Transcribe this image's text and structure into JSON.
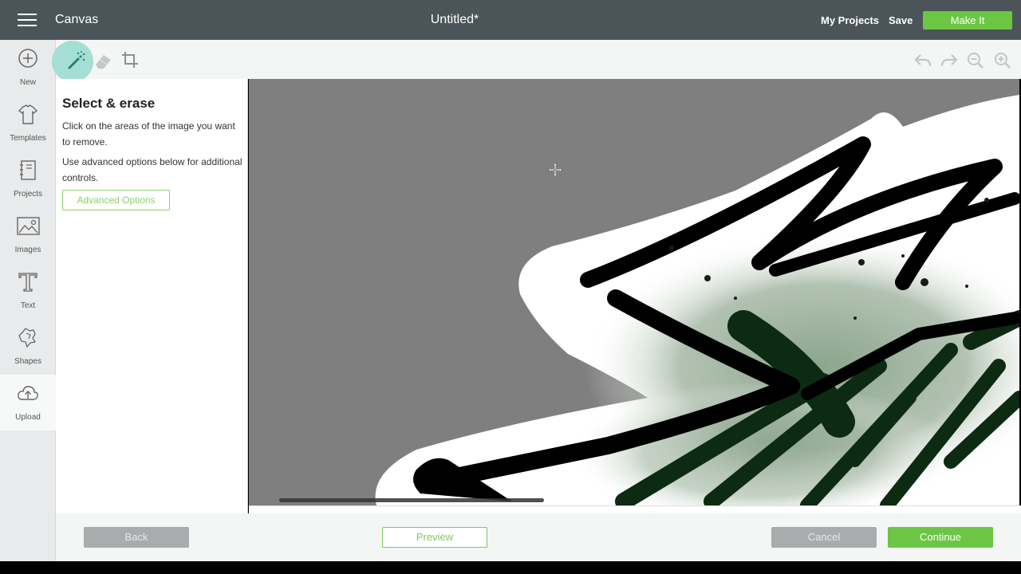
{
  "header": {
    "app_title": "Canvas",
    "doc_title": "Untitled*",
    "my_projects": "My Projects",
    "save": "Save",
    "make_it": "Make It"
  },
  "sidebar": {
    "items": [
      {
        "label": "New",
        "icon": "plus-circle-icon"
      },
      {
        "label": "Templates",
        "icon": "tshirt-icon"
      },
      {
        "label": "Projects",
        "icon": "notebook-icon"
      },
      {
        "label": "Images",
        "icon": "image-icon"
      },
      {
        "label": "Text",
        "icon": "text-icon"
      },
      {
        "label": "Shapes",
        "icon": "shapes-icon"
      },
      {
        "label": "Upload",
        "icon": "cloud-upload-icon"
      }
    ]
  },
  "toolbar": {
    "tools": [
      "magic-wand-icon",
      "eraser-icon",
      "crop-icon"
    ],
    "right_tools": [
      "undo-icon",
      "redo-icon",
      "zoom-out-icon",
      "zoom-in-icon"
    ]
  },
  "panel": {
    "title": "Select & erase",
    "text1": "Click on the areas of the image you want to remove.",
    "text2": "Use advanced options below for additional controls.",
    "advanced_options": "Advanced Options"
  },
  "footer": {
    "back": "Back",
    "preview": "Preview",
    "cancel": "Cancel",
    "continue": "Continue"
  },
  "colors": {
    "topbar": "#4b5458",
    "accent_green": "#6cc644",
    "canvas_bg": "#7f7f7f"
  }
}
